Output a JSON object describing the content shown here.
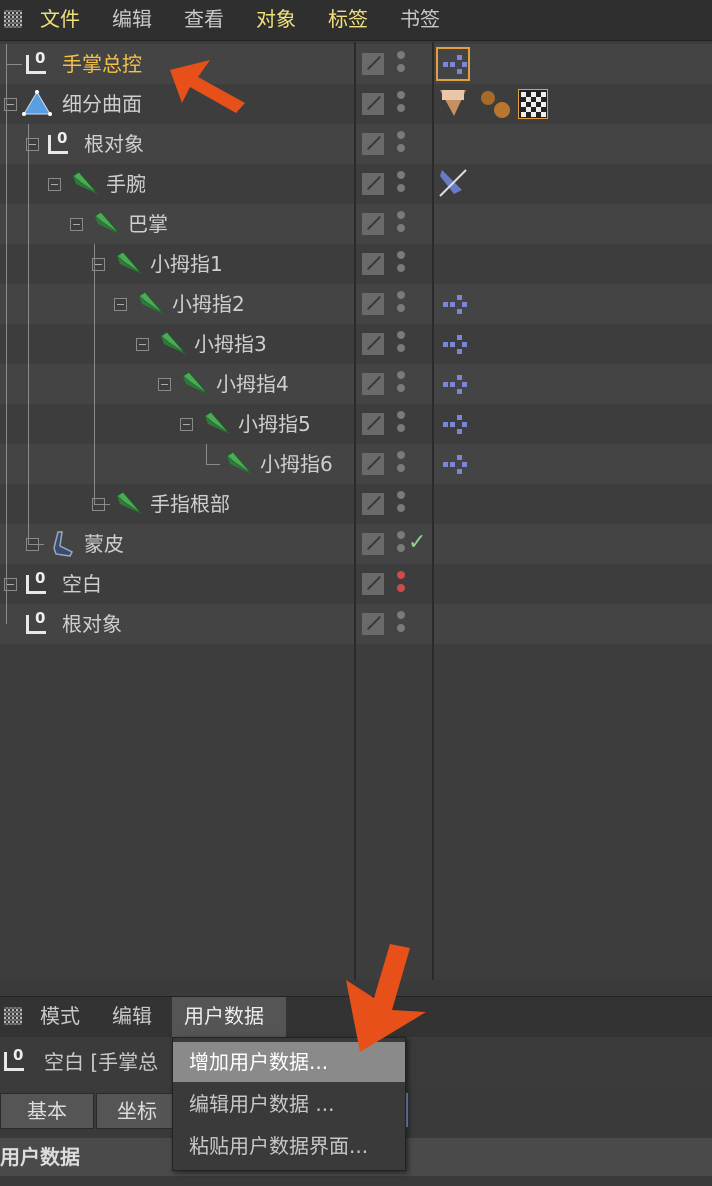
{
  "menu": {
    "items": [
      {
        "label": "文件",
        "highlight": true
      },
      {
        "label": "编辑",
        "highlight": false
      },
      {
        "label": "查看",
        "highlight": false
      },
      {
        "label": "对象",
        "highlight": true
      },
      {
        "label": "标签",
        "highlight": true
      },
      {
        "label": "书签",
        "highlight": false
      }
    ]
  },
  "objects": [
    {
      "name": "手掌总控",
      "type": "null-icon",
      "selected": true
    },
    {
      "name": "细分曲面",
      "type": "subdivision-icon"
    },
    {
      "name": "根对象",
      "type": "null-icon"
    },
    {
      "name": "手腕",
      "type": "joint-icon"
    },
    {
      "name": "巴掌",
      "type": "joint-icon"
    },
    {
      "name": "小拇指1",
      "type": "joint-icon"
    },
    {
      "name": "小拇指2",
      "type": "joint-icon"
    },
    {
      "name": "小拇指3",
      "type": "joint-icon"
    },
    {
      "name": "小拇指4",
      "type": "joint-icon"
    },
    {
      "name": "小拇指5",
      "type": "joint-icon"
    },
    {
      "name": "小拇指6",
      "type": "joint-icon"
    },
    {
      "name": "手指根部",
      "type": "joint-icon"
    },
    {
      "name": "蒙皮",
      "type": "skin-icon"
    },
    {
      "name": "空白",
      "type": "null-icon"
    },
    {
      "name": "根对象",
      "type": "null-icon"
    }
  ],
  "skin_check": "✓",
  "attributes": {
    "tabs": [
      "模式",
      "编辑",
      "用户数据"
    ],
    "object_title": "空白 [手掌总",
    "buttons": [
      "基本",
      "坐标"
    ],
    "section": "用户数据"
  },
  "popup": {
    "items": [
      "增加用户数据...",
      "编辑用户数据 ...",
      "粘贴用户数据界面..."
    ]
  },
  "colors": {
    "accent_orange": "#e8501a",
    "selected_text": "#f3c14a",
    "menu_highlight": "#f0e07c"
  }
}
